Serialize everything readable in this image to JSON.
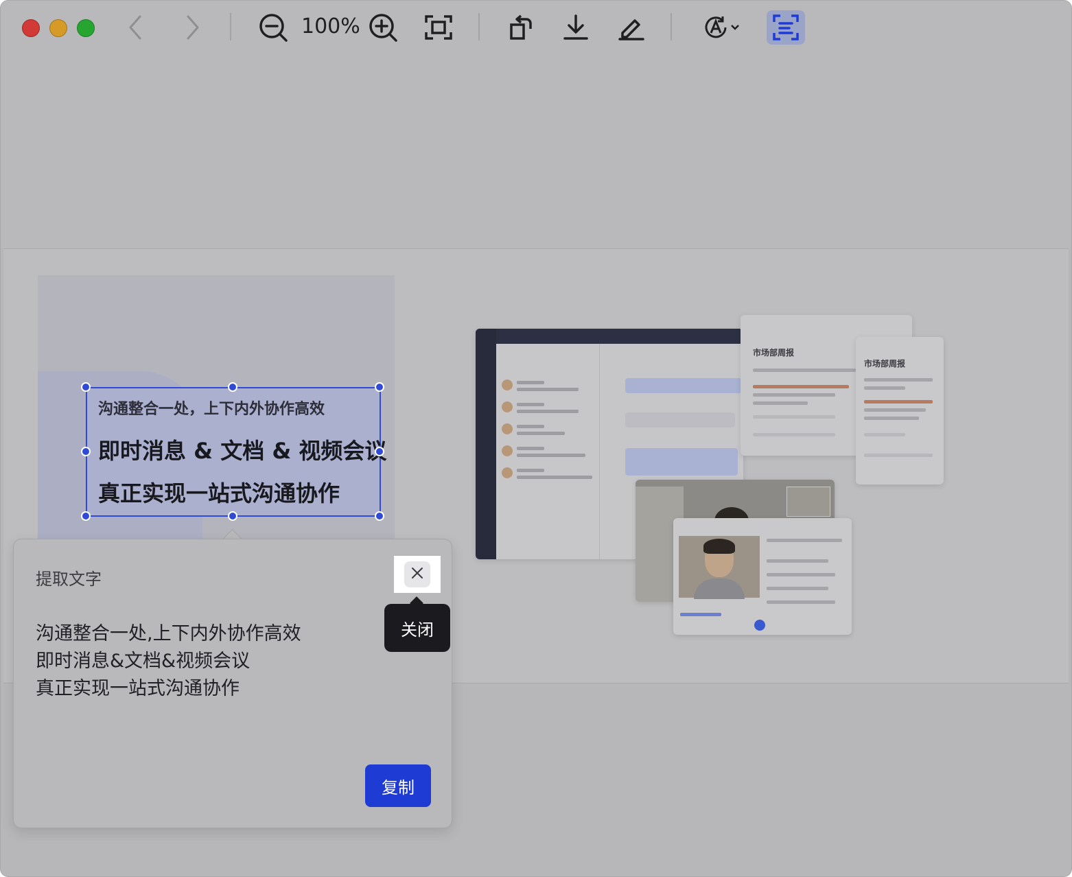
{
  "toolbar": {
    "zoom_level": "100%",
    "icons": [
      "back-icon",
      "forward-icon",
      "zoom-out-icon",
      "zoom-in-icon",
      "fit-screen-icon",
      "rotate-icon",
      "download-icon",
      "edit-icon",
      "text-recognition-icon",
      "extract-text-icon"
    ],
    "active_tool": "extract-text-icon",
    "colors": {
      "accent": "#1e3bd4",
      "red": "#d13a36",
      "yellow": "#d69a27",
      "green": "#26a631"
    }
  },
  "selection": {
    "line1": "沟通整合一处，上下内外协作高效",
    "line2": "即时消息 & 文档 & 视频会议",
    "line3": "真正实现一站式沟通协作"
  },
  "mockups": {
    "doc1_title": "市场部周报",
    "doc2_title": "市场部周报"
  },
  "popover": {
    "title": "提取文字",
    "extracted_text": "沟通整合一处,上下内外协作高效\n即时消息&文档&视频会议\n真正实现一站式沟通协作",
    "close_tooltip": "关闭",
    "copy_label": "复制"
  }
}
